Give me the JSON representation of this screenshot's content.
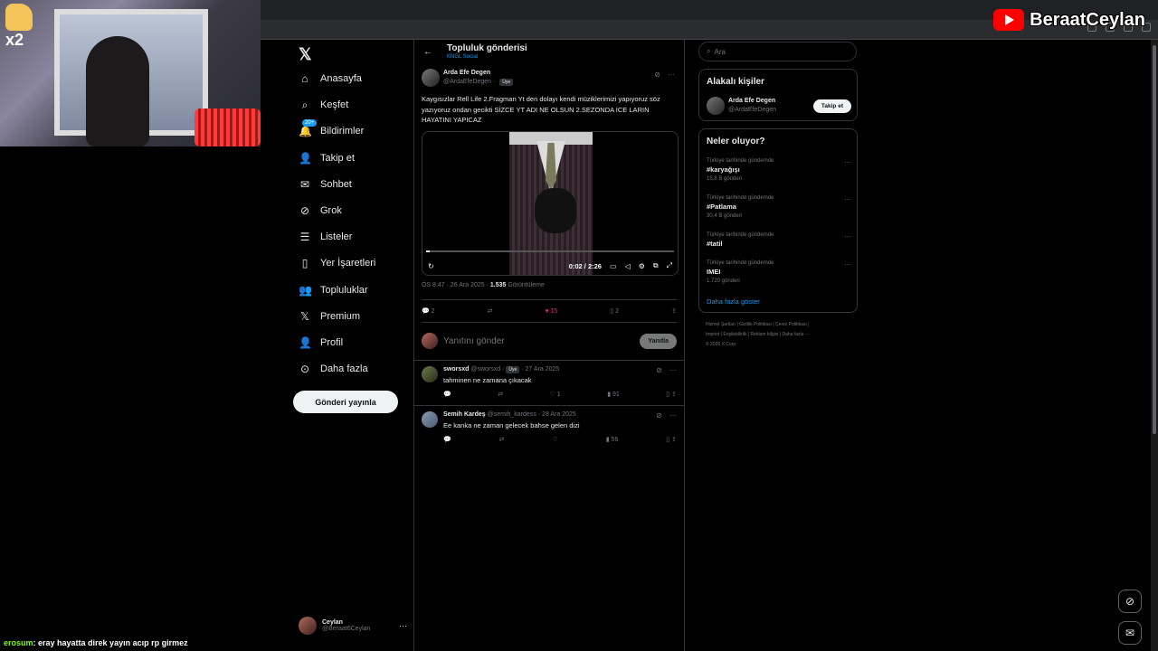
{
  "overlay": {
    "multiplier": "x2",
    "channel_name": "BeraatCeylan",
    "chat_user": "erosum",
    "chat_message": ": eray hayatta direk yayın acıp rp girmez"
  },
  "nav": {
    "items": [
      {
        "label": "Anasayfa",
        "icon": "home-icon"
      },
      {
        "label": "Keşfet",
        "icon": "search-icon"
      },
      {
        "label": "Bildirimler",
        "icon": "bell-icon",
        "badge": "20+"
      },
      {
        "label": "Takip et",
        "icon": "person-add-icon"
      },
      {
        "label": "Sohbet",
        "icon": "mail-icon"
      },
      {
        "label": "Grok",
        "icon": "grok-icon"
      },
      {
        "label": "Listeler",
        "icon": "list-icon"
      },
      {
        "label": "Yer İşaretleri",
        "icon": "bookmark-icon"
      },
      {
        "label": "Topluluklar",
        "icon": "communities-icon"
      },
      {
        "label": "Premium",
        "icon": "x-icon"
      },
      {
        "label": "Profil",
        "icon": "profile-icon"
      },
      {
        "label": "Daha fazla",
        "icon": "more-circle-icon"
      }
    ],
    "post_button": "Gönderi yayınla",
    "account": {
      "name": "Ceylan",
      "handle": "@Beraat6Ceylan"
    }
  },
  "main": {
    "title": "Topluluk gönderisi",
    "subtitle": "KNGL Social",
    "post": {
      "author": "Arda Efe Degen",
      "handle": "@ArdaEfeDegen",
      "badge": "Üye",
      "text": "Kaygısızlar Rell Life 2.Fragman Yt den dolayı kendi müziklerimizi yapıyoruz söz yazıyoruz ondan gecikti SİZCE YT ADI NE OLSUN 2.SEZONDA ICE LARIN HAYATINI YAPICAZ",
      "video_time": "0:02 / 2:26",
      "video_progress": 0.015,
      "time": "ÖS 8:47 · 26 Ara 2025 · ",
      "views": "1.535",
      "views_label": " Görüntüleme",
      "replies": "2",
      "reposts": "",
      "likes": "15",
      "bookmarks": "2"
    },
    "reply_placeholder": "Yanıtını gönder",
    "reply_button": "Yanıtla",
    "replies": [
      {
        "name": "sworsxd",
        "handle": "@sworsxd",
        "badge": "Üye",
        "date": "· 27 Ara 2025",
        "text": "tahminen ne zamana çıkacak",
        "likes": "1",
        "views": "91"
      },
      {
        "name": "Semih Kardeş",
        "handle": "@semih_kardess",
        "badge": "",
        "date": "· 28 Ara 2025",
        "text": "Ee kanka ne zaman gelecek bahse gelen dizi",
        "likes": "",
        "views": "56"
      }
    ]
  },
  "right": {
    "search_placeholder": "Ara",
    "related_title": "Alakalı kişiler",
    "related_user": {
      "name": "Arda Efe Degen",
      "handle": "@ArdaEfeDegen",
      "button": "Takip et"
    },
    "trends_title": "Neler oluyor?",
    "trends": [
      {
        "context": "Türkiye tarihinde gündemde",
        "tag": "#karyağışı",
        "count": "15,8 B gönderi"
      },
      {
        "context": "Türkiye tarihinde gündemde",
        "tag": "#Patlama",
        "count": "30,4 B gönderi"
      },
      {
        "context": "Türkiye tarihinde gündemde",
        "tag": "#tatil",
        "count": ""
      },
      {
        "context": "Türkiye tarihinde gündemde",
        "tag": "IMEI",
        "count": "1.720 gönderi"
      }
    ],
    "show_more": "Daha fazla göster",
    "footer": {
      "line1": "Hizmet Şartları  |  Gizlilik Politikası  |  Çerez Politikası  |",
      "line2": "Imprint  |  Erişilebilirlik  |  Reklam bilgisi  |  Daha fazla ···",
      "line3": "© 2026 X Corp."
    }
  },
  "colors": {
    "accent": "#1d9bf0",
    "like": "#f91880",
    "border": "#2f3336",
    "muted": "#71767b"
  }
}
